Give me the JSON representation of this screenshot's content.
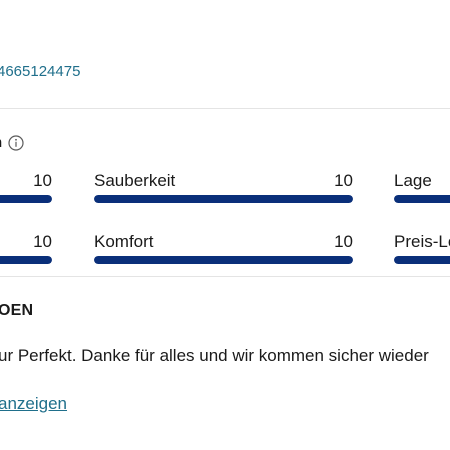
{
  "reference": {
    "id_text": "4665124475"
  },
  "ratings": {
    "heading": "n",
    "info_icon": "info-icon",
    "bar_color": "#0a2f7a",
    "categories": [
      {
        "label": "",
        "score": "10",
        "fraction": 1.0
      },
      {
        "label": "Sauberkeit",
        "score": "10",
        "fraction": 1.0
      },
      {
        "label": "Lage",
        "score": "",
        "fraction": 1.0
      },
      {
        "label": "",
        "score": "10",
        "fraction": 1.0
      },
      {
        "label": "Komfort",
        "score": "10",
        "fraction": 1.0
      },
      {
        "label": "Preis-Le",
        "score": "",
        "fraction": 1.0
      }
    ]
  },
  "review": {
    "title": "OEN",
    "text": "ur Perfekt. Danke für alles und wir kommen sicher wieder",
    "link_label": "anzeigen"
  },
  "colors": {
    "link": "#1f6f8b",
    "divider": "#e4e4e4"
  }
}
